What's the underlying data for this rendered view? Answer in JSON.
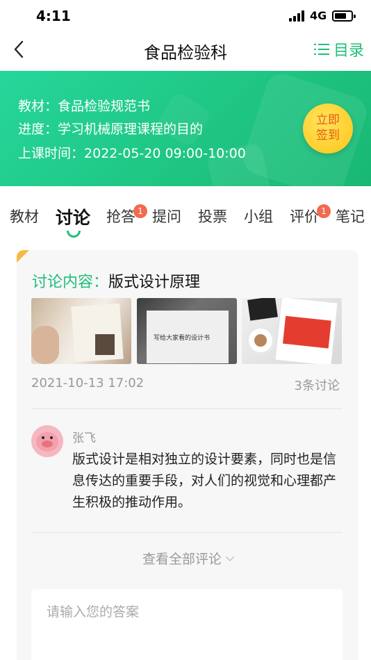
{
  "status": {
    "time": "4:11",
    "network": "4G"
  },
  "nav": {
    "title": "食品检验科",
    "catalog_label": "目录"
  },
  "banner": {
    "textbook_label": "教材：",
    "textbook": "食品检验规范书",
    "progress_label": "进度：",
    "progress": "学习机械原理课程的目的",
    "time_label": "上课时间：",
    "class_time": "2022-05-20  09:00-10:00",
    "checkin_line1": "立即",
    "checkin_line2": "签到"
  },
  "tabs": [
    {
      "label": "教材"
    },
    {
      "label": "讨论",
      "active": true
    },
    {
      "label": "抢答",
      "badge": "1"
    },
    {
      "label": "提问"
    },
    {
      "label": "投票"
    },
    {
      "label": "小组"
    },
    {
      "label": "评价",
      "badge": "1"
    },
    {
      "label": "笔记"
    }
  ],
  "discussion": {
    "title_label": "讨论内容：",
    "title": "版式设计原理",
    "photo2_text": "写给大家看的设计书",
    "date": "2021-10-13  17:02",
    "count": "3条讨论",
    "comment": {
      "author": "张飞",
      "text": "版式设计是相对独立的设计要素，同时也是信息传达的重要手段，对人们的视觉和心理都产生积极的推动作用。"
    },
    "view_all": "查看全部评论",
    "answer_placeholder": "请输入您的答案"
  }
}
